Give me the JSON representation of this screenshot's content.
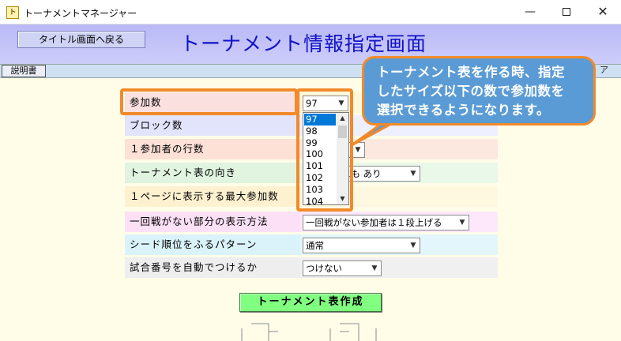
{
  "window": {
    "icon_text": "ト",
    "title": "トーナメントマネージャー",
    "minimize": "—",
    "close": "✕"
  },
  "header": {
    "back_button": "タイトル画面へ戻る",
    "title": "トーナメント情報指定画面"
  },
  "subbar": {
    "manual_button": "説明書",
    "right_button_partial": "ア"
  },
  "settings": [
    {
      "label": "参加数",
      "value": "97"
    },
    {
      "label": "ブロック数",
      "value": ""
    },
    {
      "label": "１参加者の行数",
      "value": ""
    },
    {
      "label": "トーナメント表の向き",
      "value": "とも あり"
    },
    {
      "label": "１ページに表示する最大参加数",
      "value": ""
    },
    {
      "label": "一回戦がない部分の表示方法",
      "value": "一回戦がない参加者は１段上げる"
    },
    {
      "label": "シード順位をふるパターン",
      "value": "通常"
    },
    {
      "label": "試合番号を自動でつけるか",
      "value": "つけない"
    }
  ],
  "dropdown_options": [
    "97",
    "98",
    "99",
    "100",
    "101",
    "102",
    "103",
    "104"
  ],
  "dropdown_selected": "97",
  "callout": {
    "line1": "トーナメント表を作る時、指定",
    "line2": "したサイズ以下の数で参加数を",
    "line3": "選択できるようになります。"
  },
  "create_button": "トーナメント表作成",
  "colors": {
    "background": "#fffde8",
    "title_text": "#1212c8",
    "highlight": "#f28a2a",
    "callout_fill": "#5b9bd5",
    "create_button": "#80ff80",
    "dropdown_selected": "#0078d7"
  },
  "icons": [
    "app-icon",
    "minimize-icon",
    "maximize-icon",
    "close-icon",
    "chevron-down-icon",
    "scroll-up-icon",
    "scroll-down-icon"
  ]
}
